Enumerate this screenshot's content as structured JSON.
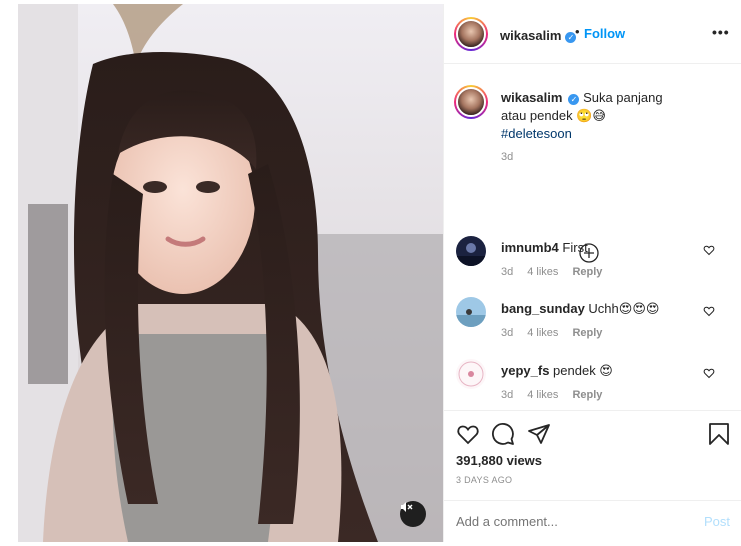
{
  "post": {
    "username": "wikasalim",
    "follow_label": "Follow",
    "dot": "•",
    "more_label": "•••",
    "caption_text": "Suka panjang atau pendek 🙄😅",
    "hashtag": "#deletesoon",
    "caption_time": "3d",
    "likes": "391,880 views",
    "posted_ago": "3 DAYS AGO",
    "add_comment_placeholder": "Add a comment...",
    "post_label": "Post"
  },
  "comments": [
    {
      "username": "imnumb4",
      "text": "First",
      "time": "3d",
      "likes": "4 likes",
      "reply": "Reply"
    },
    {
      "username": "bang_sunday",
      "text": "Uchh😍😍😍",
      "time": "3d",
      "likes": "4 likes",
      "reply": "Reply"
    },
    {
      "username": "yepy_fs",
      "text": "pendek 😍",
      "time": "3d",
      "likes": "4 likes",
      "reply": "Reply"
    }
  ],
  "icons": {
    "verified": "verified-badge-icon",
    "load_more": "plus-circle-icon",
    "like": "heart-icon",
    "comment": "comment-icon",
    "share": "paper-plane-icon",
    "save": "bookmark-icon",
    "mute": "speaker-muted-icon"
  },
  "colors": {
    "link_blue": "#0095f6",
    "verified_blue": "#3897f0",
    "muted_text": "#8e8e8e",
    "hashtag": "#00376b",
    "post_disabled": "#b2dffc"
  }
}
